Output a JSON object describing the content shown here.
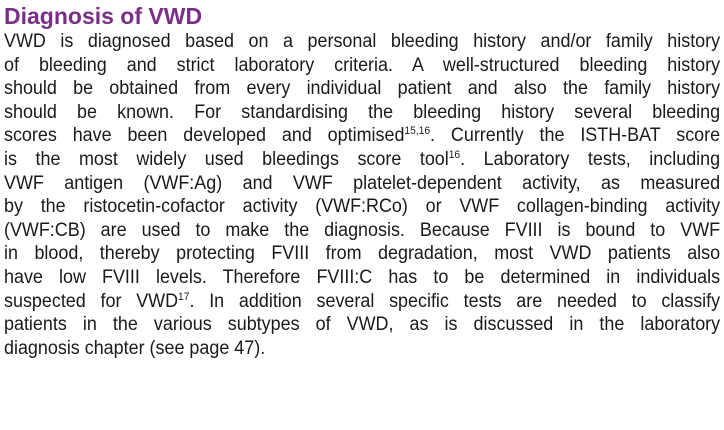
{
  "heading": "Diagnosis of VWD",
  "body": {
    "l1": "VWD is diagnosed based on a personal bleeding history and/or family history",
    "l2": "of bleeding and strict laboratory criteria. A well-structured bleeding history",
    "l3": "should be obtained from every individual patient and also the family history",
    "l4": "should be known. For standardising the bleeding history several bleeding",
    "l5a": "scores have been developed and optimised",
    "l5sup": "15,16",
    "l5b": ". Currently the ISTH-BAT score",
    "l6a": "is the most widely used bleedings score tool",
    "l6sup": "16",
    "l6b": ". Laboratory tests, including",
    "l7": "VWF antigen (VWF:Ag) and VWF platelet-dependent activity, as measured",
    "l8": "by the ristocetin-cofactor activity (VWF:RCo) or VWF collagen-binding activity",
    "l9": "(VWF:CB) are used to make the diagnosis. Because FVIII is bound to VWF",
    "l10": "in blood, thereby protecting FVIII from degradation, most VWD patients also",
    "l11": "have low FVIII levels. Therefore FVIII:C has to be determined in individuals",
    "l12a": "suspected for VWD",
    "l12sup": "17",
    "l12b": ". In addition several specific tests are needed to classify",
    "l13": "patients in the various subtypes of VWD, as is discussed in the laboratory",
    "l14": "diagnosis chapter (see page 47)."
  }
}
